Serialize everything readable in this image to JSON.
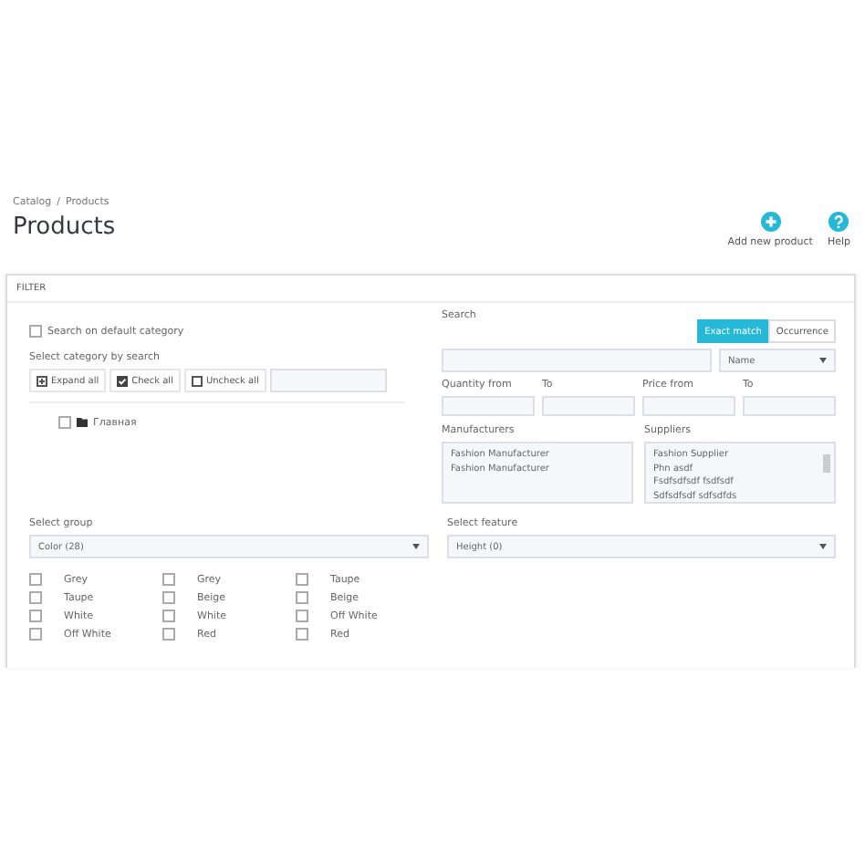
{
  "breadcrumb": [
    "Catalog",
    "/",
    "Products"
  ],
  "title": "Products",
  "toolbar": [
    {
      "kind": "add",
      "label": "Add new product"
    },
    {
      "kind": "help",
      "label": "Help"
    }
  ],
  "filter": {
    "title": "FILTER",
    "default_category": {
      "label": "Search on default category",
      "checked": false
    },
    "category_search": {
      "label": "Select category by search",
      "buttons": [
        {
          "kind": "expand",
          "label": "Expand all"
        },
        {
          "kind": "check",
          "label": "Check all"
        },
        {
          "kind": "uncheck",
          "label": "Uncheck all"
        }
      ]
    },
    "tree": [
      {
        "label": "Главная",
        "checked": false
      }
    ],
    "search": {
      "label": "Search",
      "modes": [
        {
          "label": "Exact match",
          "selected": true
        },
        {
          "label": "Occurrence",
          "selected": false
        }
      ],
      "field": "Name"
    },
    "quantity_from": "Quantity from",
    "quantity_to": "To",
    "price_from": "Price from",
    "price_to": "To",
    "manufacturers": {
      "label": "Manufacturers",
      "items": [
        "Fashion Manufacturer",
        "Fashion Manufacturer"
      ]
    },
    "suppliers": {
      "label": "Suppliers",
      "items": [
        "Fashion Supplier",
        "Phn asdf",
        "Fsdfsdfsdf fsdfsdf",
        "Sdfsdfsdf sdfsdfds"
      ]
    },
    "group": {
      "label": "Select group",
      "value": "Color (28)"
    },
    "feature": {
      "label": "Select feature",
      "value": "Height (0)"
    },
    "attributes": [
      {
        "label": "Grey",
        "checked": false
      },
      {
        "label": "Grey",
        "checked": false
      },
      {
        "label": "Taupe",
        "checked": false
      },
      {
        "label": "Taupe",
        "checked": false
      },
      {
        "label": "Beige",
        "checked": false
      },
      {
        "label": "Beige",
        "checked": false
      },
      {
        "label": "White",
        "checked": false
      },
      {
        "label": "White",
        "checked": false
      },
      {
        "label": "Off White",
        "checked": false
      },
      {
        "label": "Off White",
        "checked": false
      },
      {
        "label": "Red",
        "checked": false
      },
      {
        "label": "Red",
        "checked": false
      }
    ]
  }
}
